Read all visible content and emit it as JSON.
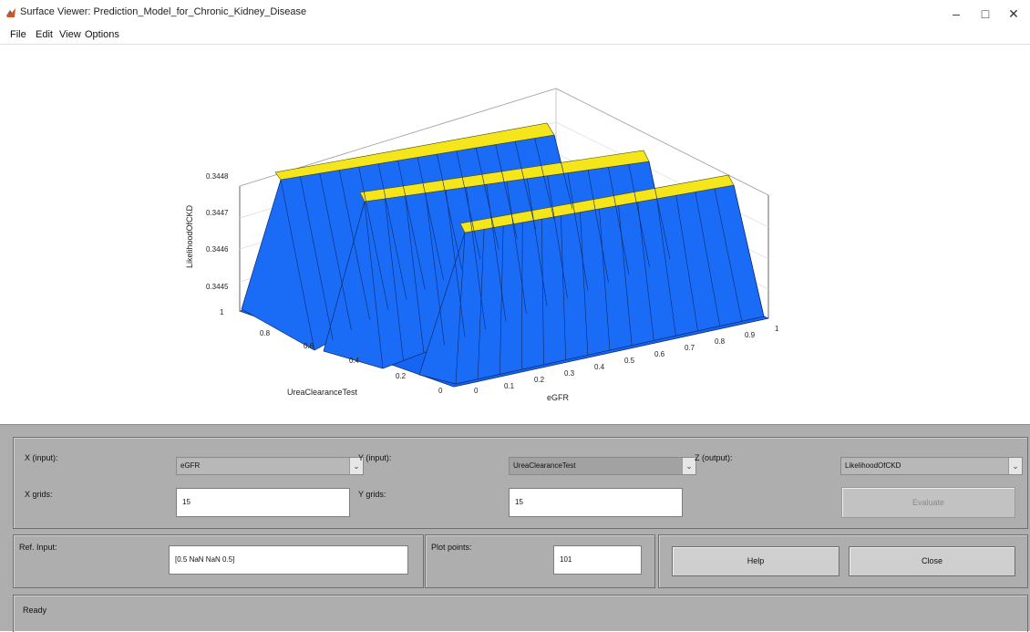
{
  "window": {
    "title": "Surface Viewer: Prediction_Model_for_Chronic_Kidney_Disease",
    "minimize": "–",
    "maximize": "□",
    "close": "✕"
  },
  "menu": [
    "File",
    "Edit",
    "View",
    "Options"
  ],
  "plot": {
    "zlabel": "LikelihoodOfCKD",
    "xlabel": "eGFR",
    "ylabel": "UreaClearanceTest",
    "z_ticks": [
      "0.3448",
      "0.3447",
      "0.3446",
      "0.3445"
    ],
    "x_ticks": [
      "0",
      "0.1",
      "0.2",
      "0.3",
      "0.4",
      "0.5",
      "0.6",
      "0.7",
      "0.8",
      "0.9",
      "1"
    ],
    "y_ticks": [
      "1",
      "0.8",
      "0.6",
      "0.4",
      "0.2",
      "0"
    ],
    "surface_color": "#1565f5",
    "top_color": "#f5e51b"
  },
  "controls": {
    "x_input_label": "X (input):",
    "x_input_value": "eGFR",
    "y_input_label": "Y (input):",
    "y_input_value": "UreaClearanceTest",
    "z_output_label": "Z (output):",
    "z_output_value": "LikelihoodOfCKD",
    "x_grids_label": "X grids:",
    "x_grids_value": "15",
    "y_grids_label": "Y grids:",
    "y_grids_value": "15",
    "evaluate_label": "Evaluate",
    "ref_input_label": "Ref. Input:",
    "ref_input_value": "[0.5 NaN NaN 0.5]",
    "plot_points_label": "Plot points:",
    "plot_points_value": "101",
    "help_label": "Help",
    "close_label": "Close",
    "status_text": "Ready",
    "dropdown_arrow": "⌄"
  }
}
